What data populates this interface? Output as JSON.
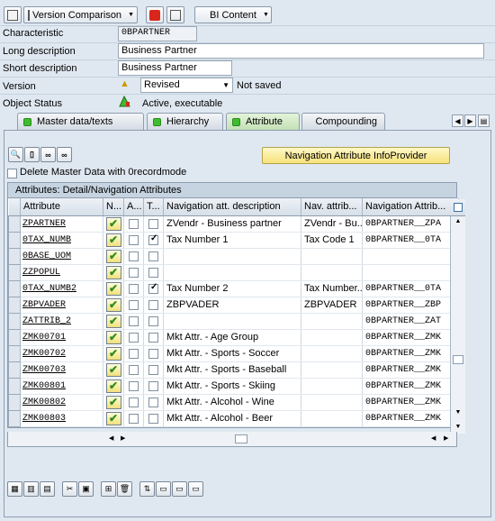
{
  "toolbar": {
    "version_comparison": "Version Comparison",
    "bi_content": "BI Content"
  },
  "form": {
    "characteristic_label": "Characteristic",
    "characteristic_value": "0BPARTNER",
    "long_desc_label": "Long description",
    "long_desc_value": "Business Partner",
    "short_desc_label": "Short description",
    "short_desc_value": "Business Partner",
    "version_label": "Version",
    "version_value": "Revised",
    "version_status": "Not saved",
    "object_status_label": "Object Status",
    "object_status_value": "Active, executable"
  },
  "tabs": [
    {
      "label": "Master data/texts"
    },
    {
      "label": "Hierarchy"
    },
    {
      "label": "Attribute"
    },
    {
      "label": "Compounding"
    }
  ],
  "panel": {
    "nav_button": "Navigation Attribute InfoProvider",
    "delete_master_label": "Delete Master Data with 0recordmode",
    "table_title": "Attributes: Detail/Navigation Attributes"
  },
  "table": {
    "headers": [
      "Attribute",
      "N...",
      "A...",
      "T...",
      "Navigation att. description",
      "Nav. attrib...",
      "Navigation Attrib..."
    ],
    "rows": [
      {
        "attr": "ZPARTNER",
        "a": false,
        "t": false,
        "desc": "ZVendr - Business partner",
        "nav": "ZVendr - Bu...",
        "navattr": "0BPARTNER__ZPA"
      },
      {
        "attr": "0TAX_NUMB",
        "a": false,
        "t": true,
        "desc": "Tax Number 1",
        "nav": "Tax Code 1",
        "navattr": "0BPARTNER__0TA"
      },
      {
        "attr": "0BASE_UOM",
        "a": false,
        "t": false,
        "desc": "",
        "nav": "",
        "navattr": ""
      },
      {
        "attr": "ZZPOPUL",
        "a": false,
        "t": false,
        "desc": "",
        "nav": "",
        "navattr": ""
      },
      {
        "attr": "0TAX_NUMB2",
        "a": false,
        "t": true,
        "desc": "Tax Number 2",
        "nav": "Tax Number...",
        "navattr": "0BPARTNER__0TA"
      },
      {
        "attr": "ZBPVADER",
        "a": false,
        "t": false,
        "desc": "ZBPVADER",
        "nav": "ZBPVADER",
        "navattr": "0BPARTNER__ZBP"
      },
      {
        "attr": "ZATTRIB_2",
        "a": false,
        "t": false,
        "desc": "",
        "nav": "",
        "navattr": "0BPARTNER__ZAT"
      },
      {
        "attr": "ZMK00701",
        "a": false,
        "t": false,
        "desc": "Mkt Attr. - Age Group",
        "nav": "",
        "navattr": "0BPARTNER__ZMK"
      },
      {
        "attr": "ZMK00702",
        "a": false,
        "t": false,
        "desc": "Mkt Attr. - Sports - Soccer",
        "nav": "",
        "navattr": "0BPARTNER__ZMK"
      },
      {
        "attr": "ZMK00703",
        "a": false,
        "t": false,
        "desc": "Mkt Attr. - Sports - Baseball",
        "nav": "",
        "navattr": "0BPARTNER__ZMK"
      },
      {
        "attr": "ZMK00801",
        "a": false,
        "t": false,
        "desc": "Mkt Attr. - Sports - Skiing",
        "nav": "",
        "navattr": "0BPARTNER__ZMK"
      },
      {
        "attr": "ZMK00802",
        "a": false,
        "t": false,
        "desc": "Mkt Attr. - Alcohol - Wine",
        "nav": "",
        "navattr": "0BPARTNER__ZMK"
      },
      {
        "attr": "ZMK00803",
        "a": false,
        "t": false,
        "desc": "Mkt Attr. - Alcohol - Beer",
        "nav": "",
        "navattr": "0BPARTNER__ZMK"
      }
    ]
  }
}
